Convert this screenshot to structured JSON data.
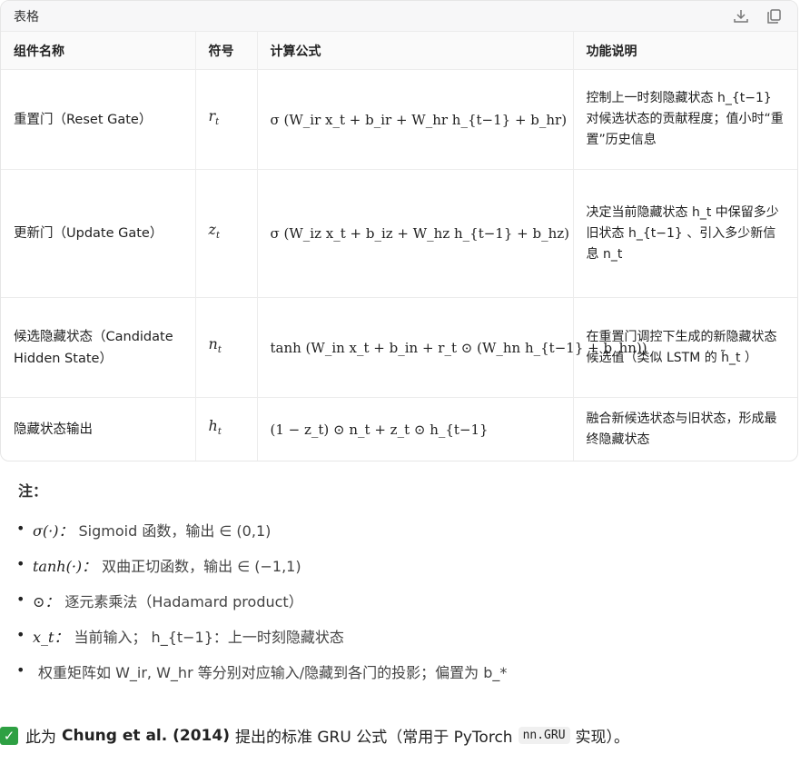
{
  "card": {
    "title": "表格",
    "download_tooltip": "下载",
    "copy_tooltip": "复制"
  },
  "table": {
    "headers": [
      "组件名称",
      "符号",
      "计算公式",
      "功能说明"
    ],
    "rows": [
      {
        "name": "重置门（Reset Gate）",
        "symbol": "r",
        "symbol_sub": "t",
        "formula": "σ (W_ir x_t + b_ir + W_hr h_{t−1} + b_hr)",
        "description": "控制上一时刻隐藏状态 h_{t−1} 对候选状态的贡献程度；值小时“重置”历史信息"
      },
      {
        "name": "更新门（Update Gate）",
        "symbol": "z",
        "symbol_sub": "t",
        "formula": "σ (W_iz x_t + b_iz + W_hz h_{t−1} + b_hz)",
        "description": "决定当前隐藏状态 h_t 中保留多少旧状态 h_{t−1} 、引入多少新信息 n_t"
      },
      {
        "name": "候选隐藏状态（Candidate Hidden State）",
        "symbol": "n",
        "symbol_sub": "t",
        "formula": "tanh (W_in x_t + b_in + r_t ⊙ (W_hn h_{t−1} + b_hn))",
        "description": "在重置门调控下生成的新隐藏状态候选值（类似 LSTM 的 h̃_t ）"
      },
      {
        "name": "隐藏状态输出",
        "symbol": "h",
        "symbol_sub": "t",
        "formula": "(1 − z_t) ⊙ n_t + z_t ⊙ h_{t−1}",
        "description": "融合新候选状态与旧状态，形成最终隐藏状态"
      }
    ]
  },
  "notes": {
    "title": "注：",
    "items": [
      {
        "symbol": "σ(·)：",
        "text": "Sigmoid 函数，输出 ∈ (0,1)"
      },
      {
        "symbol": "tanh(·)：",
        "text": "双曲正切函数，输出 ∈ (−1,1)"
      },
      {
        "symbol": "⊙：",
        "text": "逐元素乘法（Hadamard product）"
      },
      {
        "symbol": "x_t：",
        "text": "当前输入； h_{t−1}：上一时刻隐藏状态"
      },
      {
        "symbol": "",
        "text": "权重矩阵如 W_ir, W_hr 等分别对应输入/隐藏到各门的投影；偏置为 b_*"
      }
    ]
  },
  "footer": {
    "check": "✓",
    "prefix": "此为",
    "bold": "Chung et al. (2014)",
    "middle": "提出的标准 GRU 公式（常用于 PyTorch",
    "code": "nn.GRU",
    "suffix": "实现）。"
  },
  "colors": {
    "check_bg": "#2ea043",
    "border": "#ececec",
    "header_bg": "#f7f7f8"
  }
}
